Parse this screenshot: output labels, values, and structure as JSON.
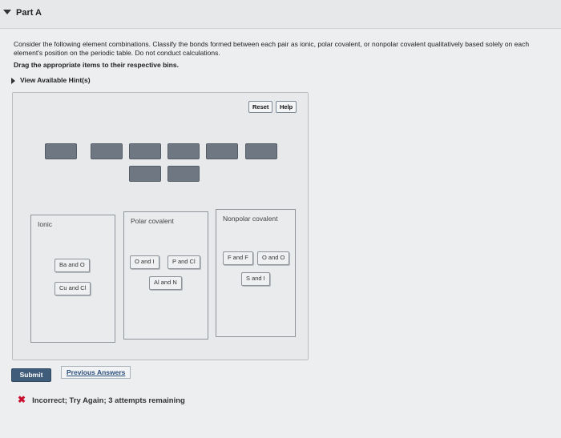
{
  "part": {
    "title": "Part A"
  },
  "question": {
    "text": "Consider the following element combinations. Classify the bonds formed between each pair as ionic, polar covalent, or nonpolar covalent qualitatively based solely on each element's position on the periodic table. Do not conduct calculations.",
    "instruction": "Drag the appropriate items to their respective bins.",
    "hints_label": "View Available Hint(s)"
  },
  "toolbar": {
    "reset_label": "Reset",
    "help_label": "Help"
  },
  "bins": [
    {
      "label": "Ionic",
      "items": [
        "Ba and O",
        "Cu and Cl"
      ]
    },
    {
      "label": "Polar covalent",
      "items": [
        "O and I",
        "P and Cl",
        "Al and N"
      ]
    },
    {
      "label": "Nonpolar covalent",
      "items": [
        "F and F",
        "O and O",
        "S and I"
      ]
    }
  ],
  "actions": {
    "submit_label": "Submit",
    "previous_answers_label": "Previous Answers"
  },
  "feedback": {
    "text": "Incorrect; Try Again; 3 attempts remaining",
    "icon": "x-icon",
    "color": "#c8102e"
  }
}
